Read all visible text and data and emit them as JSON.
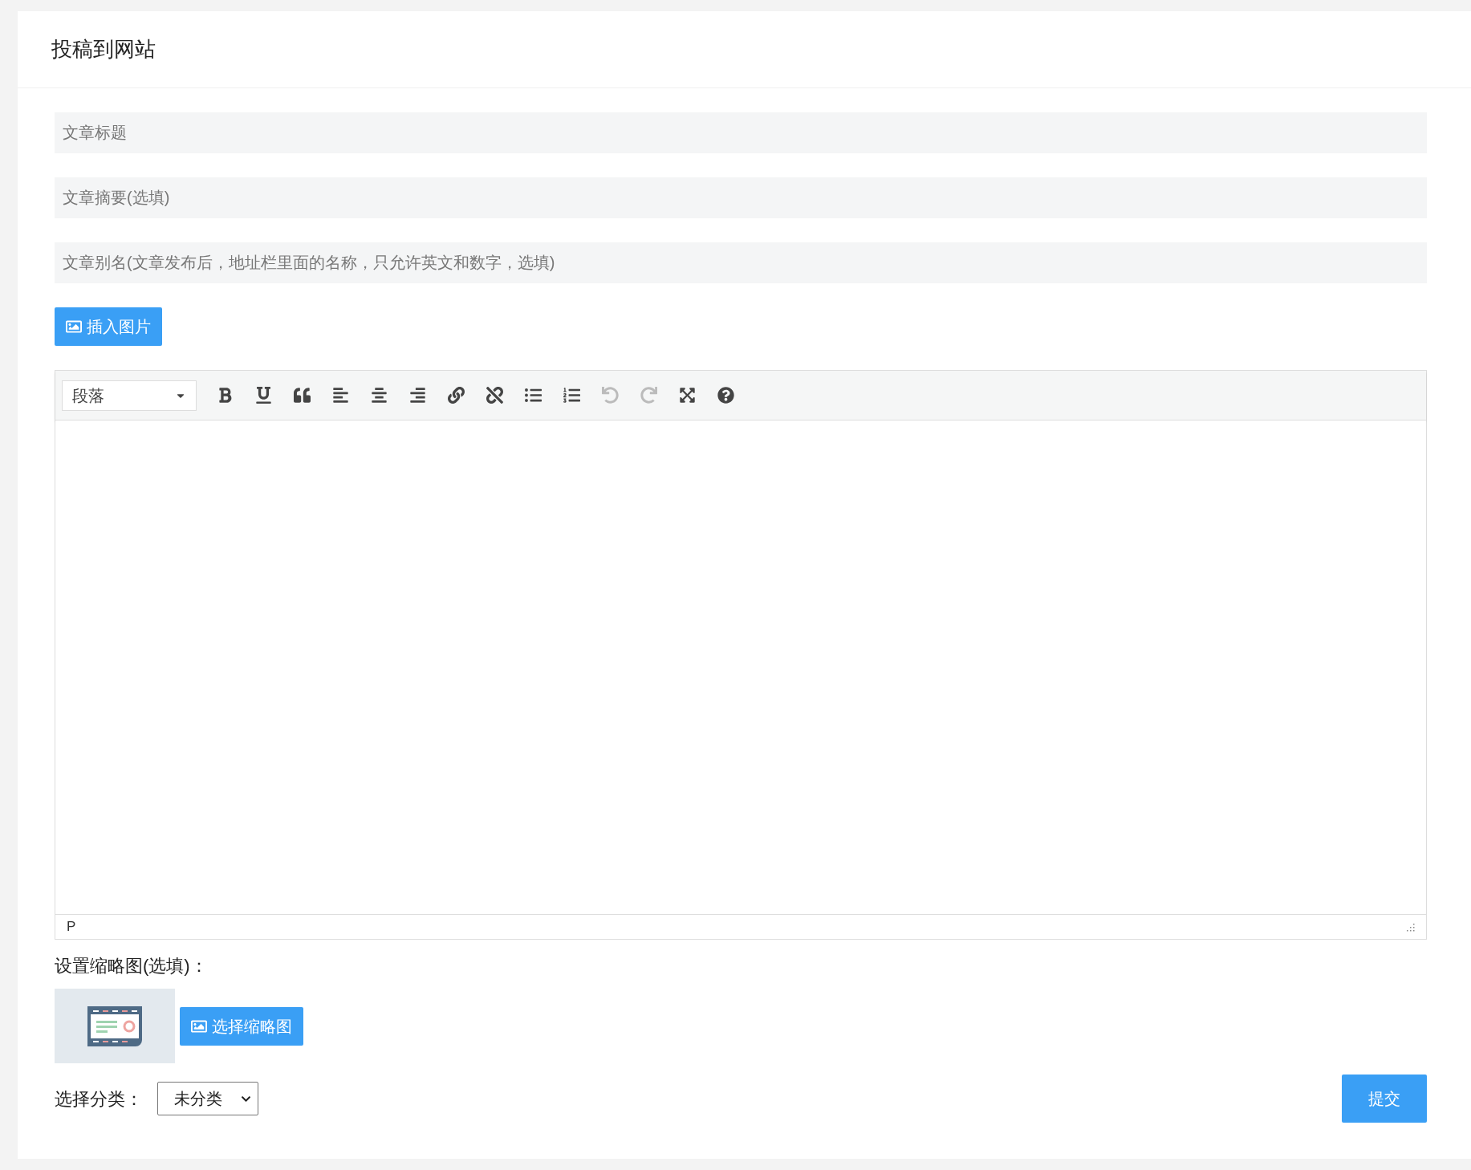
{
  "page_title": "投稿到网站",
  "fields": [
    {
      "placeholder": "文章标题"
    },
    {
      "placeholder": "文章摘要(选填)"
    },
    {
      "placeholder": "文章别名(文章发布后，地址栏里面的名称，只允许英文和数字，选填)"
    }
  ],
  "insert_image_button": "插入图片",
  "editor": {
    "format_select": "段落",
    "toolbar": [
      {
        "kind": "bold",
        "disabled": false
      },
      {
        "kind": "underline",
        "disabled": false
      },
      {
        "kind": "quote",
        "disabled": false
      },
      {
        "kind": "align-left",
        "disabled": false
      },
      {
        "kind": "align-center",
        "disabled": false
      },
      {
        "kind": "align-right",
        "disabled": false
      },
      {
        "kind": "link",
        "disabled": false
      },
      {
        "kind": "unlink",
        "disabled": false
      },
      {
        "kind": "bullet-list",
        "disabled": false
      },
      {
        "kind": "numbered-list",
        "disabled": false
      },
      {
        "kind": "undo",
        "disabled": true
      },
      {
        "kind": "redo",
        "disabled": true
      },
      {
        "kind": "fullscreen",
        "disabled": false
      },
      {
        "kind": "help",
        "disabled": false
      }
    ],
    "status_path": "P"
  },
  "thumbnail_label": "设置缩略图(选填)：",
  "choose_thumbnail_button": "选择缩略图",
  "category_label": "选择分类：",
  "category_select": "未分类",
  "submit_button": "提交"
}
